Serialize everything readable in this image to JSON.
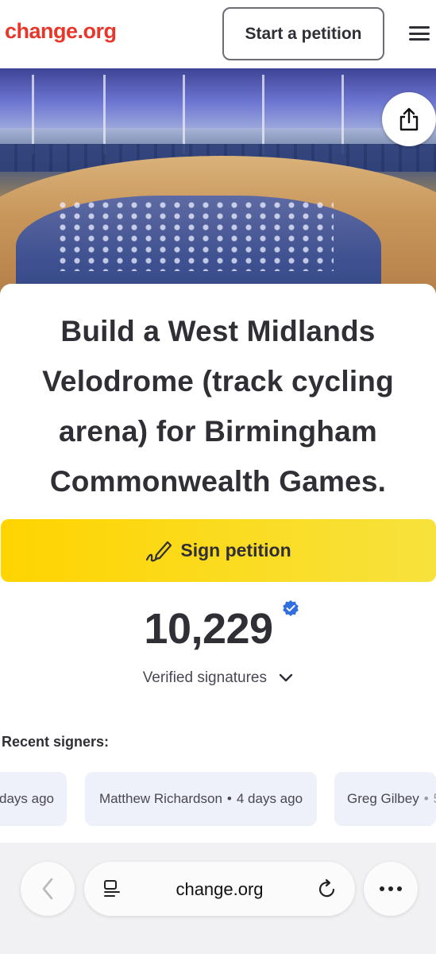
{
  "header": {
    "logo": "change.org",
    "start_button": "Start a petition",
    "menu_icon": "hamburger-menu-icon"
  },
  "hero": {
    "image_description_icon": "velodrome-photo",
    "share_icon": "share-icon"
  },
  "petition": {
    "title": "Build a West Midlands Velodrome (track cycling arena) for Birmingham Commonwealth Games.",
    "sign_button": "Sign petition",
    "signature_count": "10,229",
    "verified_label": "Verified signatures"
  },
  "recent_signers": {
    "heading": "Recent signers:",
    "items": [
      {
        "name": "",
        "time": "days ago"
      },
      {
        "name": "Matthew Richardson",
        "time": "4 days ago"
      },
      {
        "name": "Greg Gilbey",
        "time": "5"
      }
    ]
  },
  "browser": {
    "url": "change.org"
  },
  "colors": {
    "brand": "#e8372a",
    "sign_yellow": "#ffd400",
    "text": "#312f36",
    "verified_blue": "#2f6fdf"
  }
}
